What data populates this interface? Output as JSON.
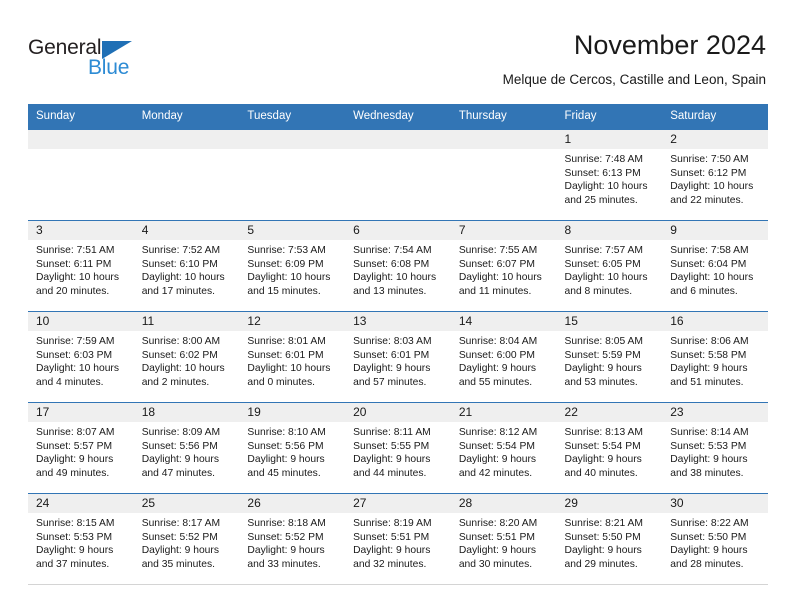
{
  "brand": {
    "name_dark": "General",
    "name_blue": "Blue",
    "triangle_color": "#1f6fb5",
    "blue_color": "#2d8bd4"
  },
  "header": {
    "title": "November 2024",
    "subtitle": "Melque de Cercos, Castille and Leon, Spain",
    "header_bg": "#3275b5",
    "daynum_bg": "#efefef"
  },
  "weekdays": [
    "Sunday",
    "Monday",
    "Tuesday",
    "Wednesday",
    "Thursday",
    "Friday",
    "Saturday"
  ],
  "labels": {
    "sunrise": "Sunrise:",
    "sunset": "Sunset:",
    "daylight": "Daylight:"
  },
  "weeks": [
    [
      {
        "day": "",
        "empty": true
      },
      {
        "day": "",
        "empty": true
      },
      {
        "day": "",
        "empty": true
      },
      {
        "day": "",
        "empty": true
      },
      {
        "day": "",
        "empty": true
      },
      {
        "day": "1",
        "sunrise": "Sunrise: 7:48 AM",
        "sunset": "Sunset: 6:13 PM",
        "daylight": "Daylight: 10 hours and 25 minutes."
      },
      {
        "day": "2",
        "sunrise": "Sunrise: 7:50 AM",
        "sunset": "Sunset: 6:12 PM",
        "daylight": "Daylight: 10 hours and 22 minutes."
      }
    ],
    [
      {
        "day": "3",
        "sunrise": "Sunrise: 7:51 AM",
        "sunset": "Sunset: 6:11 PM",
        "daylight": "Daylight: 10 hours and 20 minutes."
      },
      {
        "day": "4",
        "sunrise": "Sunrise: 7:52 AM",
        "sunset": "Sunset: 6:10 PM",
        "daylight": "Daylight: 10 hours and 17 minutes."
      },
      {
        "day": "5",
        "sunrise": "Sunrise: 7:53 AM",
        "sunset": "Sunset: 6:09 PM",
        "daylight": "Daylight: 10 hours and 15 minutes."
      },
      {
        "day": "6",
        "sunrise": "Sunrise: 7:54 AM",
        "sunset": "Sunset: 6:08 PM",
        "daylight": "Daylight: 10 hours and 13 minutes."
      },
      {
        "day": "7",
        "sunrise": "Sunrise: 7:55 AM",
        "sunset": "Sunset: 6:07 PM",
        "daylight": "Daylight: 10 hours and 11 minutes."
      },
      {
        "day": "8",
        "sunrise": "Sunrise: 7:57 AM",
        "sunset": "Sunset: 6:05 PM",
        "daylight": "Daylight: 10 hours and 8 minutes."
      },
      {
        "day": "9",
        "sunrise": "Sunrise: 7:58 AM",
        "sunset": "Sunset: 6:04 PM",
        "daylight": "Daylight: 10 hours and 6 minutes."
      }
    ],
    [
      {
        "day": "10",
        "sunrise": "Sunrise: 7:59 AM",
        "sunset": "Sunset: 6:03 PM",
        "daylight": "Daylight: 10 hours and 4 minutes."
      },
      {
        "day": "11",
        "sunrise": "Sunrise: 8:00 AM",
        "sunset": "Sunset: 6:02 PM",
        "daylight": "Daylight: 10 hours and 2 minutes."
      },
      {
        "day": "12",
        "sunrise": "Sunrise: 8:01 AM",
        "sunset": "Sunset: 6:01 PM",
        "daylight": "Daylight: 10 hours and 0 minutes."
      },
      {
        "day": "13",
        "sunrise": "Sunrise: 8:03 AM",
        "sunset": "Sunset: 6:01 PM",
        "daylight": "Daylight: 9 hours and 57 minutes."
      },
      {
        "day": "14",
        "sunrise": "Sunrise: 8:04 AM",
        "sunset": "Sunset: 6:00 PM",
        "daylight": "Daylight: 9 hours and 55 minutes."
      },
      {
        "day": "15",
        "sunrise": "Sunrise: 8:05 AM",
        "sunset": "Sunset: 5:59 PM",
        "daylight": "Daylight: 9 hours and 53 minutes."
      },
      {
        "day": "16",
        "sunrise": "Sunrise: 8:06 AM",
        "sunset": "Sunset: 5:58 PM",
        "daylight": "Daylight: 9 hours and 51 minutes."
      }
    ],
    [
      {
        "day": "17",
        "sunrise": "Sunrise: 8:07 AM",
        "sunset": "Sunset: 5:57 PM",
        "daylight": "Daylight: 9 hours and 49 minutes."
      },
      {
        "day": "18",
        "sunrise": "Sunrise: 8:09 AM",
        "sunset": "Sunset: 5:56 PM",
        "daylight": "Daylight: 9 hours and 47 minutes."
      },
      {
        "day": "19",
        "sunrise": "Sunrise: 8:10 AM",
        "sunset": "Sunset: 5:56 PM",
        "daylight": "Daylight: 9 hours and 45 minutes."
      },
      {
        "day": "20",
        "sunrise": "Sunrise: 8:11 AM",
        "sunset": "Sunset: 5:55 PM",
        "daylight": "Daylight: 9 hours and 44 minutes."
      },
      {
        "day": "21",
        "sunrise": "Sunrise: 8:12 AM",
        "sunset": "Sunset: 5:54 PM",
        "daylight": "Daylight: 9 hours and 42 minutes."
      },
      {
        "day": "22",
        "sunrise": "Sunrise: 8:13 AM",
        "sunset": "Sunset: 5:54 PM",
        "daylight": "Daylight: 9 hours and 40 minutes."
      },
      {
        "day": "23",
        "sunrise": "Sunrise: 8:14 AM",
        "sunset": "Sunset: 5:53 PM",
        "daylight": "Daylight: 9 hours and 38 minutes."
      }
    ],
    [
      {
        "day": "24",
        "sunrise": "Sunrise: 8:15 AM",
        "sunset": "Sunset: 5:53 PM",
        "daylight": "Daylight: 9 hours and 37 minutes."
      },
      {
        "day": "25",
        "sunrise": "Sunrise: 8:17 AM",
        "sunset": "Sunset: 5:52 PM",
        "daylight": "Daylight: 9 hours and 35 minutes."
      },
      {
        "day": "26",
        "sunrise": "Sunrise: 8:18 AM",
        "sunset": "Sunset: 5:52 PM",
        "daylight": "Daylight: 9 hours and 33 minutes."
      },
      {
        "day": "27",
        "sunrise": "Sunrise: 8:19 AM",
        "sunset": "Sunset: 5:51 PM",
        "daylight": "Daylight: 9 hours and 32 minutes."
      },
      {
        "day": "28",
        "sunrise": "Sunrise: 8:20 AM",
        "sunset": "Sunset: 5:51 PM",
        "daylight": "Daylight: 9 hours and 30 minutes."
      },
      {
        "day": "29",
        "sunrise": "Sunrise: 8:21 AM",
        "sunset": "Sunset: 5:50 PM",
        "daylight": "Daylight: 9 hours and 29 minutes."
      },
      {
        "day": "30",
        "sunrise": "Sunrise: 8:22 AM",
        "sunset": "Sunset: 5:50 PM",
        "daylight": "Daylight: 9 hours and 28 minutes."
      }
    ]
  ]
}
